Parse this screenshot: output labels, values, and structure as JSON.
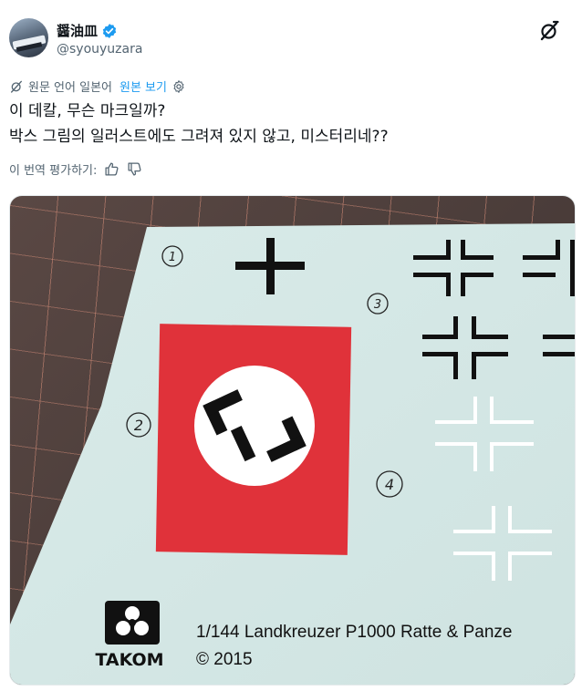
{
  "author": {
    "display_name": "醤油皿",
    "handle": "@syouyuzara",
    "verified": true
  },
  "header_icons": [
    "grok-icon",
    "verified-badge-icon"
  ],
  "translation": {
    "source_note": "원문 언어 일본어",
    "show_original_label": "원본 보기"
  },
  "tweet": {
    "line1": "이 데칼, 무슨 마크일까?",
    "line2": "박스 그림의 일러스트에도 그려져 있지 않고, 미스터리네??"
  },
  "rating": {
    "label": "이 번역 평가하기:"
  },
  "media": {
    "decal_numbers": [
      "1",
      "2",
      "3",
      "4"
    ],
    "brand": "TAKOM",
    "product_line": "1/144 Landkreuzer P1000 Ratte & Panze",
    "copyright": "© 2015"
  },
  "colors": {
    "accent": "#1d9bf0",
    "decal_red": "#e0323a",
    "sheet": "#d6e8e6"
  }
}
